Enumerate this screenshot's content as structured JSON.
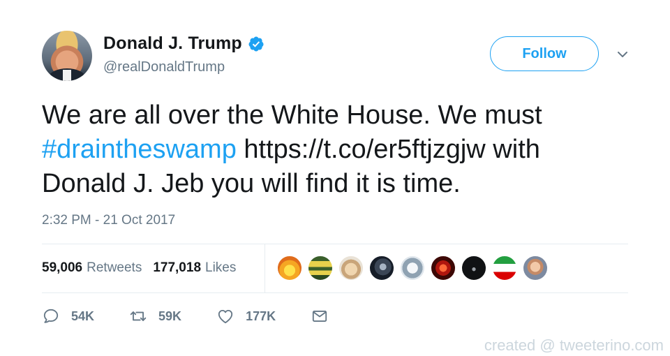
{
  "author": {
    "display_name": "Donald J. Trump",
    "handle": "@realDonaldTrump",
    "verified_icon": "verified-badge-icon"
  },
  "follow_label": "Follow",
  "tweet": {
    "text_line_1": "We are all over the White House. We must",
    "hashtag": "#draintheswamp",
    "text_after_hashtag": " https://t.co/er5ftjzgjw with",
    "text_line_3": "Donald J. Jeb you will find it is time.",
    "timestamp": "2:32 PM - 21 Oct 2017"
  },
  "stats": {
    "retweets_count": "59,006",
    "retweets_label": "Retweets",
    "likes_count": "177,018",
    "likes_label": "Likes"
  },
  "actions": {
    "reply_count": "54K",
    "retweet_count": "59K",
    "like_count": "177K"
  },
  "colors": {
    "accent": "#1da1f2",
    "muted": "#657786",
    "text": "#14171a",
    "divider": "#e6ecf0"
  },
  "watermark": "created @ tweeterino.com"
}
